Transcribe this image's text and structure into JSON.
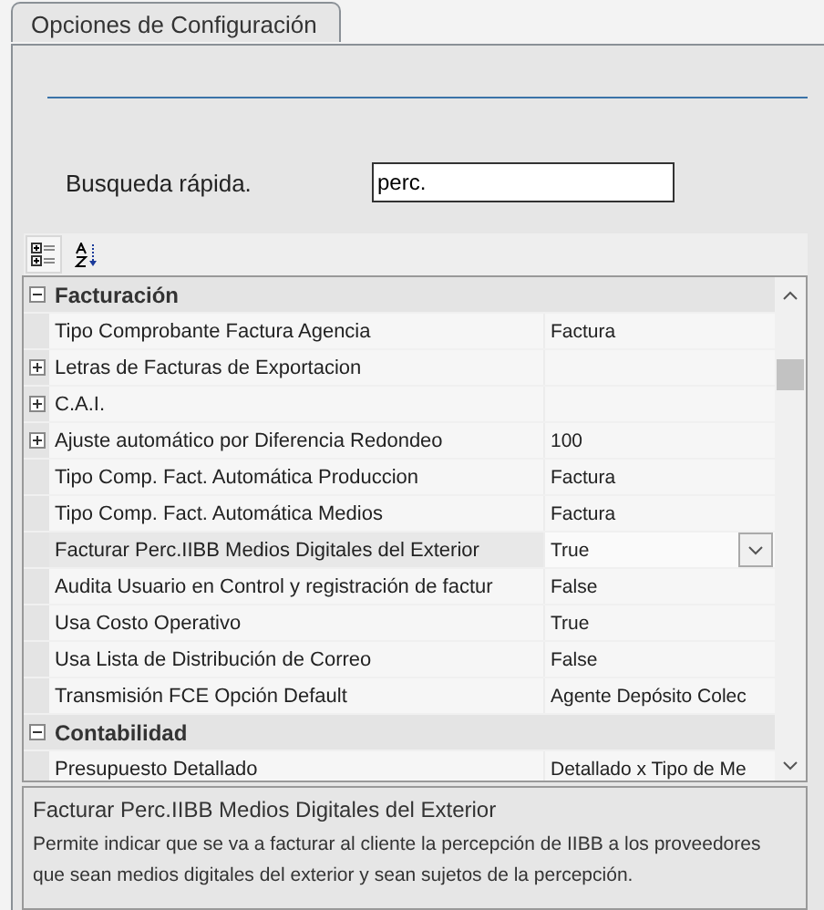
{
  "tab": {
    "label": "Opciones de Configuración",
    "selected": true
  },
  "search": {
    "label": "Busqueda rápida.",
    "value": "perc."
  },
  "toolbar": [
    {
      "kind": "categorized",
      "selected": true
    },
    {
      "kind": "alphabetical",
      "selected": false
    }
  ],
  "grid": {
    "rows": [
      {
        "kind": "category",
        "name": "Facturación",
        "expanded": true
      },
      {
        "kind": "property",
        "name": "Tipo Comprobante Factura Agencia",
        "value": "Factura",
        "expandable": false,
        "selected": false
      },
      {
        "kind": "property",
        "name": "Letras de Facturas de Exportacion",
        "expandable": true,
        "selected": false
      },
      {
        "kind": "property",
        "name": "C.A.I.",
        "expandable": true,
        "selected": false
      },
      {
        "kind": "property",
        "name": "Ajuste automático por Diferencia Redondeo",
        "value": "100",
        "expandable": true,
        "selected": false
      },
      {
        "kind": "property",
        "name": "Tipo Comp. Fact. Automática Produccion",
        "value": "Factura",
        "expandable": false,
        "selected": false
      },
      {
        "kind": "property",
        "name": "Tipo Comp. Fact. Automática Medios",
        "value": "Factura",
        "expandable": false,
        "selected": false
      },
      {
        "kind": "property",
        "name": "Facturar Perc.IIBB Medios Digitales del Exterior",
        "value": "True",
        "expandable": false,
        "selected": true
      },
      {
        "kind": "property",
        "name": "Audita Usuario en Control y registración de factur",
        "value": "False",
        "expandable": false,
        "selected": false
      },
      {
        "kind": "property",
        "name": "Usa Costo Operativo",
        "value": "True",
        "expandable": false,
        "selected": false
      },
      {
        "kind": "property",
        "name": "Usa Lista de Distribución de Correo",
        "value": "False",
        "expandable": false,
        "selected": false
      },
      {
        "kind": "property",
        "name": "Transmisión FCE Opción Default",
        "value": "Agente Depósito Colec",
        "expandable": false,
        "selected": false
      },
      {
        "kind": "category",
        "name": "Contabilidad",
        "expanded": true
      },
      {
        "kind": "property",
        "name": "Presupuesto Detallado",
        "value": "Detallado x Tipo de Me",
        "expandable": false,
        "selected": false
      }
    ]
  },
  "description": {
    "title": "Facturar Perc.IIBB Medios Digitales del Exterior",
    "text": "Permite indicar que se va a facturar al cliente la percepción de IIBB a los proveedores que sean medios digitales del exterior y sean sujetos de la percepción."
  }
}
